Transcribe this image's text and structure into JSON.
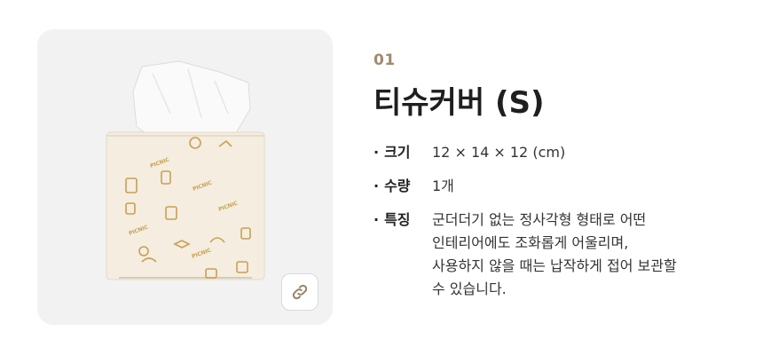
{
  "product": {
    "number": "01",
    "title": "티슈커버 (S)",
    "link_icon": "link-icon",
    "accent": "#a08a6e",
    "box_color": "#f4ede0",
    "pattern_color": "#c9a050"
  },
  "specs": [
    {
      "label": "크기",
      "value_lines": [
        "12 × 14 × 12 (cm)"
      ]
    },
    {
      "label": "수량",
      "value_lines": [
        "1개"
      ]
    },
    {
      "label": "특징",
      "value_lines": [
        "군더더기 없는 정사각형 형태로 어떤",
        "인테리어에도 조화롭게 어울리며,",
        "사용하지 않을 때는 납작하게 접어 보관할",
        "수 있습니다."
      ]
    }
  ],
  "bullet": "·"
}
